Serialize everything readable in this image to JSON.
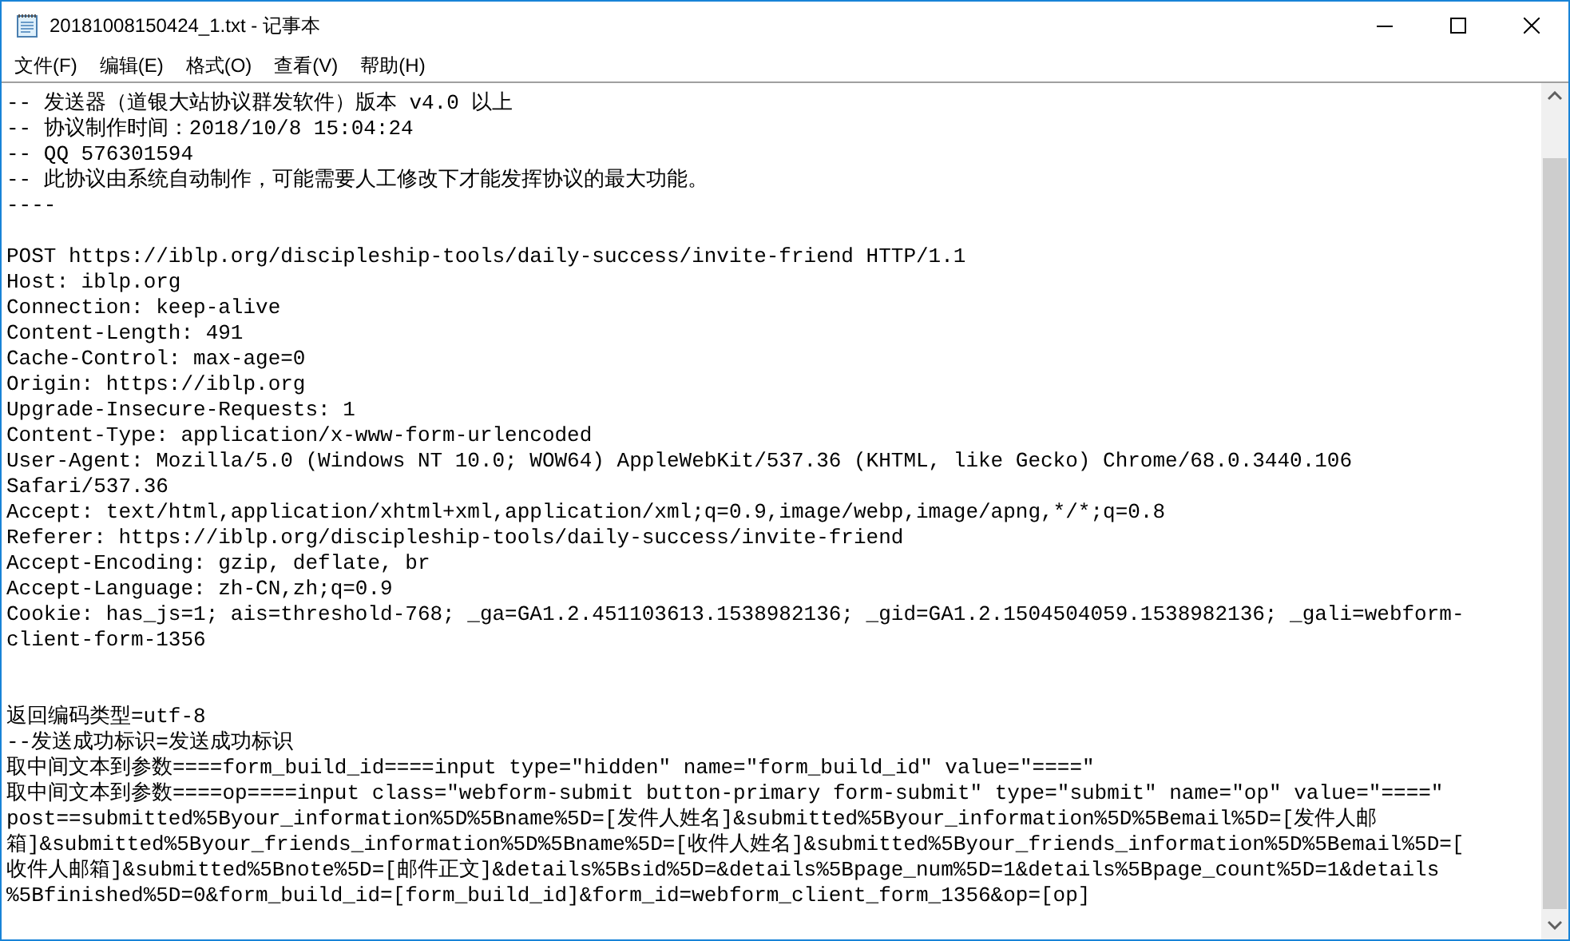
{
  "window": {
    "title": "20181008150424_1.txt - 记事本"
  },
  "menu": [
    "文件(F)",
    "编辑(E)",
    "格式(O)",
    "查看(V)",
    "帮助(H)"
  ],
  "document": {
    "lines": [
      {
        "kind": "line",
        "text": "-- 发送器（道银大站协议群发软件）版本 v4.0 以上"
      },
      {
        "kind": "line",
        "text": "-- 协议制作时间：2018/10/8 15:04:24"
      },
      {
        "kind": "line",
        "text": "-- QQ 576301594"
      },
      {
        "kind": "line",
        "text": "-- 此协议由系统自动制作，可能需要人工修改下才能发挥协议的最大功能。"
      },
      {
        "kind": "line",
        "text": "----"
      },
      {
        "kind": "blank"
      },
      {
        "kind": "line",
        "text": "POST https://iblp.org/discipleship-tools/daily-success/invite-friend HTTP/1.1"
      },
      {
        "kind": "line",
        "text": "Host: iblp.org"
      },
      {
        "kind": "line",
        "text": "Connection: keep-alive"
      },
      {
        "kind": "line",
        "text": "Content-Length: 491"
      },
      {
        "kind": "line",
        "text": "Cache-Control: max-age=0"
      },
      {
        "kind": "line",
        "text": "Origin: https://iblp.org"
      },
      {
        "kind": "line",
        "text": "Upgrade-Insecure-Requests: 1"
      },
      {
        "kind": "line",
        "text": "Content-Type: application/x-www-form-urlencoded"
      },
      {
        "kind": "line",
        "text": "User-Agent: Mozilla/5.0 (Windows NT 10.0; WOW64) AppleWebKit/537.36 (KHTML, like Gecko) Chrome/68.0.3440.106"
      },
      {
        "kind": "line",
        "text": "Safari/537.36"
      },
      {
        "kind": "line",
        "text": "Accept: text/html,application/xhtml+xml,application/xml;q=0.9,image/webp,image/apng,*/*;q=0.8"
      },
      {
        "kind": "line",
        "text": "Referer: https://iblp.org/discipleship-tools/daily-success/invite-friend"
      },
      {
        "kind": "line",
        "text": "Accept-Encoding: gzip, deflate, br"
      },
      {
        "kind": "line",
        "text": "Accept-Language: zh-CN,zh;q=0.9"
      },
      {
        "kind": "line",
        "text": "Cookie: has_js=1; ais=threshold-768; _ga=GA1.2.451103613.1538982136; _gid=GA1.2.1504504059.1538982136; _gali=webform-"
      },
      {
        "kind": "line",
        "text": "client-form-1356"
      },
      {
        "kind": "blank"
      },
      {
        "kind": "blank"
      },
      {
        "kind": "line",
        "text": "返回编码类型=utf-8"
      },
      {
        "kind": "line",
        "text": "--发送成功标识=发送成功标识"
      },
      {
        "kind": "line",
        "text": "取中间文本到参数====form_build_id====input type=\"hidden\" name=\"form_build_id\" value=\"====\""
      },
      {
        "kind": "line",
        "text": "取中间文本到参数====op====input class=\"webform-submit button-primary form-submit\" type=\"submit\" name=\"op\" value=\"====\""
      },
      {
        "kind": "line",
        "text": "post==submitted%5Byour_information%5D%5Bname%5D=[发件人姓名]&submitted%5Byour_information%5D%5Bemail%5D=[发件人邮"
      },
      {
        "kind": "line",
        "text": "箱]&submitted%5Byour_friends_information%5D%5Bname%5D=[收件人姓名]&submitted%5Byour_friends_information%5D%5Bemail%5D=["
      },
      {
        "kind": "line",
        "text": "收件人邮箱]&submitted%5Bnote%5D=[邮件正文]&details%5Bsid%5D=&details%5Bpage_num%5D=1&details%5Bpage_count%5D=1&details"
      },
      {
        "kind": "line",
        "text": "%5Bfinished%5D=0&form_build_id=[form_build_id]&form_id=webform_client_form_1356&op=[op]"
      }
    ]
  }
}
